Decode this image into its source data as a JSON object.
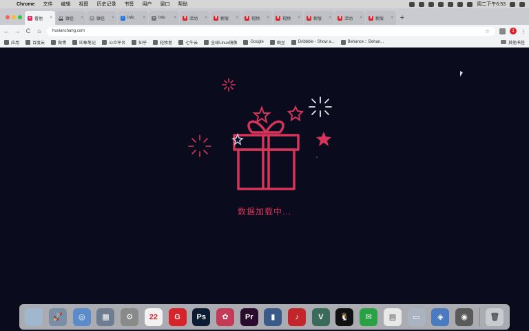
{
  "menubar": {
    "apple": "",
    "items": [
      "Chrome",
      "文件",
      "编辑",
      "视图",
      "历史记录",
      "书签",
      "用户",
      "窗口",
      "帮助"
    ],
    "clock": "周二下午6:53"
  },
  "tabs": [
    {
      "label": "看他",
      "color": "#e0245e",
      "glyph": "●"
    },
    {
      "label": "微信",
      "color": "#555555",
      "glyph": "GG"
    },
    {
      "label": "微信",
      "color": "#999999",
      "glyph": "▪"
    },
    {
      "label": "Info",
      "color": "#1a73e8",
      "glyph": "i"
    },
    {
      "label": "Info",
      "color": "#777777",
      "glyph": "▪"
    },
    {
      "label": "活动",
      "color": "#d8232a",
      "glyph": "H"
    },
    {
      "label": "新版",
      "color": "#d8232a",
      "glyph": "H"
    },
    {
      "label": "视频",
      "color": "#d8232a",
      "glyph": "H"
    },
    {
      "label": "视频",
      "color": "#d8232a",
      "glyph": "H"
    },
    {
      "label": "新版",
      "color": "#d8232a",
      "glyph": "H"
    },
    {
      "label": "活动",
      "color": "#d8232a",
      "glyph": "H"
    },
    {
      "label": "新版",
      "color": "#d8232a",
      "glyph": "H"
    }
  ],
  "newtab_label": "+",
  "toolbar": {
    "back": "←",
    "forward": "→",
    "reload": "C",
    "home": "⌂",
    "url": "huxianchang.com",
    "star": "☆",
    "profile_badge": "1",
    "menu": "⋮"
  },
  "bookmarks": {
    "items": [
      "应用",
      "百度云",
      "微博",
      "印象笔记",
      "公众平台",
      "知乎",
      "轻牧者",
      "七牛云",
      "全球Linux镜像",
      "Google",
      "豌豆",
      "Dribbble - Show a...",
      "Behance :: Behan..."
    ],
    "other": "其他书签"
  },
  "page": {
    "loading_text": "数据加载中...",
    "accent": "#d6345a",
    "background": "#0b0b1e"
  },
  "dock": {
    "apps": [
      {
        "name": "finder",
        "color": "#9fb8d0",
        "glyph": ""
      },
      {
        "name": "launchpad",
        "color": "#7a8fa6",
        "glyph": "🚀"
      },
      {
        "name": "safari",
        "color": "#5b8bc9",
        "glyph": "◎"
      },
      {
        "name": "preview",
        "color": "#6e7d90",
        "glyph": "▦"
      },
      {
        "name": "system-preferences",
        "color": "#8a8a8a",
        "glyph": "⚙"
      },
      {
        "name": "calendar",
        "color": "#f2f2f2",
        "glyph": "22"
      },
      {
        "name": "ganttproject",
        "color": "#d8232a",
        "glyph": "G"
      },
      {
        "name": "photoshop",
        "color": "#0c1c32",
        "glyph": "Ps"
      },
      {
        "name": "mindmap",
        "color": "#c43b5a",
        "glyph": "✿"
      },
      {
        "name": "premiere",
        "color": "#2a0b2e",
        "glyph": "Pr"
      },
      {
        "name": "keynote",
        "color": "#3a5a8a",
        "glyph": "▮"
      },
      {
        "name": "netease-music",
        "color": "#c2262b",
        "glyph": "♪"
      },
      {
        "name": "vue",
        "color": "#3a6a5a",
        "glyph": "V"
      },
      {
        "name": "qq",
        "color": "#111111",
        "glyph": "🐧"
      },
      {
        "name": "wechat",
        "color": "#2aa145",
        "glyph": "✉"
      },
      {
        "name": "notes",
        "color": "#e8e8e8",
        "glyph": "▤"
      },
      {
        "name": "desktop",
        "color": "#aab4c0",
        "glyph": "▭"
      },
      {
        "name": "app-store",
        "color": "#4a7ac0",
        "glyph": "◈"
      },
      {
        "name": "screencast",
        "color": "#5a5a5a",
        "glyph": "◉"
      },
      {
        "name": "trash",
        "color": "#c8ccd2",
        "glyph": "🗑"
      }
    ]
  }
}
